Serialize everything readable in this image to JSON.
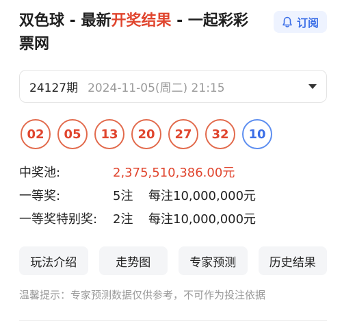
{
  "header": {
    "title_part1": "双色球 - 最新",
    "title_highlight": "开奖结果",
    "title_part2": " - 一起彩彩票网",
    "subscribe_label": "订阅",
    "subscribe_icon": "bell-icon"
  },
  "issue": {
    "number": "24127期",
    "date": "2024-11-05(周二) 21:15",
    "dropdown_icon": "caret-down-icon"
  },
  "balls": {
    "red": [
      "02",
      "05",
      "13",
      "20",
      "27",
      "32"
    ],
    "blue": [
      "10"
    ]
  },
  "info": {
    "pool_label": "中奖池:",
    "pool_value": "2,375,510,386.00元",
    "first_label": "一等奖:",
    "first_count": "5注",
    "first_amount": "每注10,000,000元",
    "special_label": "一等奖特别奖:",
    "special_count": "2注",
    "special_amount": "每注10,000,000元"
  },
  "buttons": [
    "玩法介绍",
    "走势图",
    "专家预测",
    "历史结果"
  ],
  "tip": "温馨提示：专家预测数据仅供参考，不可作为投注依据",
  "colors": {
    "accent_red": "#e0452e",
    "accent_blue": "#3c6fe7"
  }
}
